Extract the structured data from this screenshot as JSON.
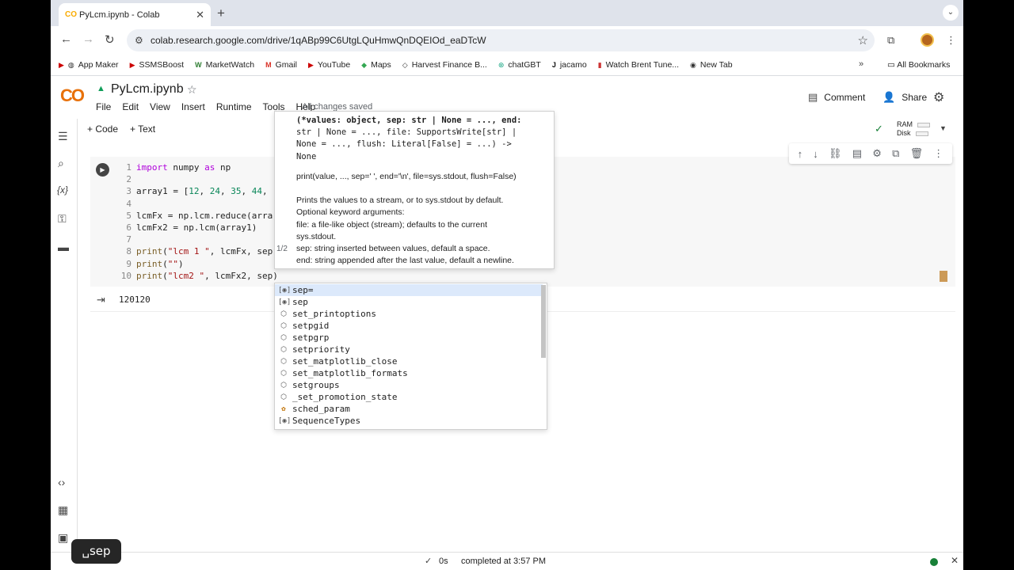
{
  "browser": {
    "tab_title": "PyLcm.ipynb - Colab",
    "tab_favicon": "CO",
    "url": "colab.research.google.com/drive/1qABp99C6UtgLQuHmwQnDQEIOd_eaDTcW",
    "bookmarks": [
      "App Maker",
      "SSMSBoost",
      "MarketWatch",
      "Gmail",
      "YouTube",
      "Maps",
      "Harvest Finance B...",
      "chatGBT",
      "jacamo",
      "Watch Brent Tune...",
      "New Tab"
    ],
    "all_bookmarks": "All Bookmarks",
    "more": "»"
  },
  "colab": {
    "logo": "CO",
    "notebook_title": "PyLcm.ipynb",
    "menu": [
      "File",
      "Edit",
      "View",
      "Insert",
      "Runtime",
      "Tools",
      "Help"
    ],
    "save_status": "All changes saved",
    "comment_label": "Comment",
    "share_label": "Share",
    "add_code": "+ Code",
    "add_text": "+ Text",
    "ram_label": "RAM",
    "disk_label": "Disk"
  },
  "cell": {
    "output": "120120",
    "lines": [
      "1",
      "2",
      "3",
      "4",
      "5",
      "6",
      "7",
      "8",
      "9",
      "10"
    ]
  },
  "signature": {
    "sig_line1": "(*values: object, sep: str | None = ..., end:",
    "sig_line2": "str | None = ..., file: SupportsWrite[str] |",
    "sig_line3": "None = ..., flush: Literal[False] = ...) ->",
    "sig_line4": "None",
    "doc_line1": "print(value, ..., sep=' ', end='\\n', file=sys.stdout, flush=False)",
    "doc_line2": "Prints the values to a stream, or to sys.stdout by default.",
    "doc_line3": "Optional keyword arguments:",
    "doc_line4": "file:  a file-like object (stream); defaults to the current",
    "doc_line5": "sys.stdout.",
    "doc_line6": "sep:   string inserted between values, default a space.",
    "doc_line7": "end:   string appended after the last value, default a newline.",
    "pager": "1/2"
  },
  "suggestions": [
    "sep=",
    "sep",
    "set_printoptions",
    "setpgid",
    "setpgrp",
    "setpriority",
    "set_matplotlib_close",
    "set_matplotlib_formats",
    "setgroups",
    "_set_promotion_state",
    "sched_param",
    "SequenceTypes"
  ],
  "status": {
    "check": "✓",
    "time": "0s",
    "completed": "completed at 3:57 PM"
  },
  "overlay": {
    "key_badge": "␣sep"
  }
}
